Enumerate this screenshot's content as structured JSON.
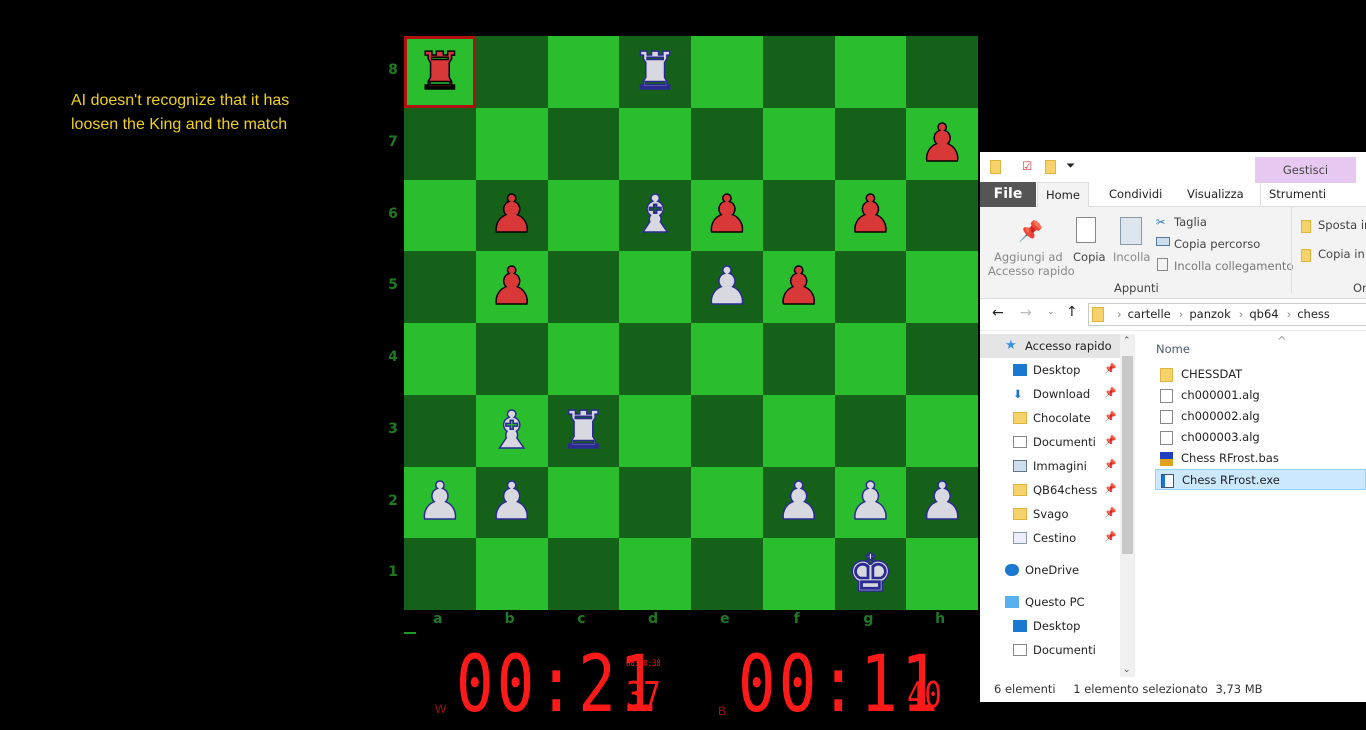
{
  "annotation": {
    "line1": "AI doesn't recognize that it has",
    "line2": "loosen the King and the match"
  },
  "board": {
    "colors": {
      "light": "#2abd2e",
      "dark": "#16611a",
      "black_piece": "#d83838",
      "white_piece": "#d8d8e0",
      "highlight": "#b01010"
    },
    "files": [
      "a",
      "b",
      "c",
      "d",
      "e",
      "f",
      "g",
      "h"
    ],
    "ranks": [
      "8",
      "7",
      "6",
      "5",
      "4",
      "3",
      "2",
      "1"
    ],
    "highlighted_square": "a8",
    "pieces": [
      {
        "square": "a8",
        "piece": "rook",
        "color": "black"
      },
      {
        "square": "d8",
        "piece": "rook",
        "color": "white"
      },
      {
        "square": "h7",
        "piece": "pawn",
        "color": "black"
      },
      {
        "square": "b6",
        "piece": "pawn",
        "color": "black"
      },
      {
        "square": "d6",
        "piece": "bishop",
        "color": "white"
      },
      {
        "square": "e6",
        "piece": "pawn",
        "color": "black"
      },
      {
        "square": "g6",
        "piece": "pawn",
        "color": "black"
      },
      {
        "square": "b5",
        "piece": "pawn",
        "color": "black"
      },
      {
        "square": "e5",
        "piece": "pawn",
        "color": "white"
      },
      {
        "square": "f5",
        "piece": "pawn",
        "color": "black"
      },
      {
        "square": "b3",
        "piece": "bishop",
        "color": "white"
      },
      {
        "square": "c3",
        "piece": "rook",
        "color": "white"
      },
      {
        "square": "a2",
        "piece": "pawn",
        "color": "white"
      },
      {
        "square": "b2",
        "piece": "pawn",
        "color": "white"
      },
      {
        "square": "f2",
        "piece": "pawn",
        "color": "white"
      },
      {
        "square": "g2",
        "piece": "pawn",
        "color": "white"
      },
      {
        "square": "h2",
        "piece": "pawn",
        "color": "white"
      },
      {
        "square": "g1",
        "piece": "king",
        "color": "white"
      }
    ]
  },
  "clocks": {
    "white": {
      "label": "W",
      "main": "00:21",
      "seconds": "37",
      "move_time": "00:00:38"
    },
    "black": {
      "label": "B",
      "main": "00:11",
      "seconds": "40"
    }
  },
  "explorer": {
    "manage_tab": "Gestisci",
    "tabs": [
      "File",
      "Home",
      "Condividi",
      "Visualizza",
      "Strumenti applicaz"
    ],
    "ribbon": {
      "pin": "Aggiungi ad",
      "pin2": "Accesso rapido",
      "copy": "Copia",
      "paste": "Incolla",
      "cut": "Taglia",
      "copy_path": "Copia percorso",
      "paste_link": "Incolla collegamento",
      "group": "Appunti",
      "move": "Sposta in",
      "copy_to": "Copia in",
      "group2": "Or"
    },
    "path": [
      "cartelle",
      "panzok",
      "qb64",
      "chess"
    ],
    "nav": [
      {
        "label": "Accesso rapido",
        "icon": "star-icon",
        "level": 0
      },
      {
        "label": "Desktop",
        "icon": "desktop-icon",
        "level": 1,
        "pinned": true
      },
      {
        "label": "Download",
        "icon": "download-icon",
        "level": 1,
        "pinned": true
      },
      {
        "label": "Chocolate",
        "icon": "folder-icon",
        "level": 1,
        "pinned": true
      },
      {
        "label": "Documenti",
        "icon": "documents-icon",
        "level": 1,
        "pinned": true
      },
      {
        "label": "Immagini",
        "icon": "pictures-icon",
        "level": 1,
        "pinned": true
      },
      {
        "label": "QB64chess",
        "icon": "folder-icon",
        "level": 1,
        "pinned": true
      },
      {
        "label": "Svago",
        "icon": "folder-icon",
        "level": 1,
        "pinned": true
      },
      {
        "label": "Cestino",
        "icon": "recycle-bin-icon",
        "level": 1,
        "pinned": true
      },
      {
        "label": "OneDrive",
        "icon": "cloud-icon",
        "level": 0
      },
      {
        "label": "Questo PC",
        "icon": "computer-icon",
        "level": 0
      },
      {
        "label": "Desktop",
        "icon": "desktop-icon",
        "level": 1
      },
      {
        "label": "Documenti",
        "icon": "documents-icon",
        "level": 1
      }
    ],
    "column_header": "Nome",
    "files": [
      {
        "name": "CHESSDAT",
        "icon": "folder-icon"
      },
      {
        "name": "ch000001.alg",
        "icon": "file-icon"
      },
      {
        "name": "ch000002.alg",
        "icon": "file-icon"
      },
      {
        "name": "ch000003.alg",
        "icon": "file-icon"
      },
      {
        "name": "Chess RFrost.bas",
        "icon": "qb64-icon"
      },
      {
        "name": "Chess RFrost.exe",
        "icon": "exe-icon",
        "selected": true
      }
    ],
    "status": {
      "count": "6 elementi",
      "selection": "1 elemento selezionato",
      "size": "3,73 MB"
    }
  }
}
